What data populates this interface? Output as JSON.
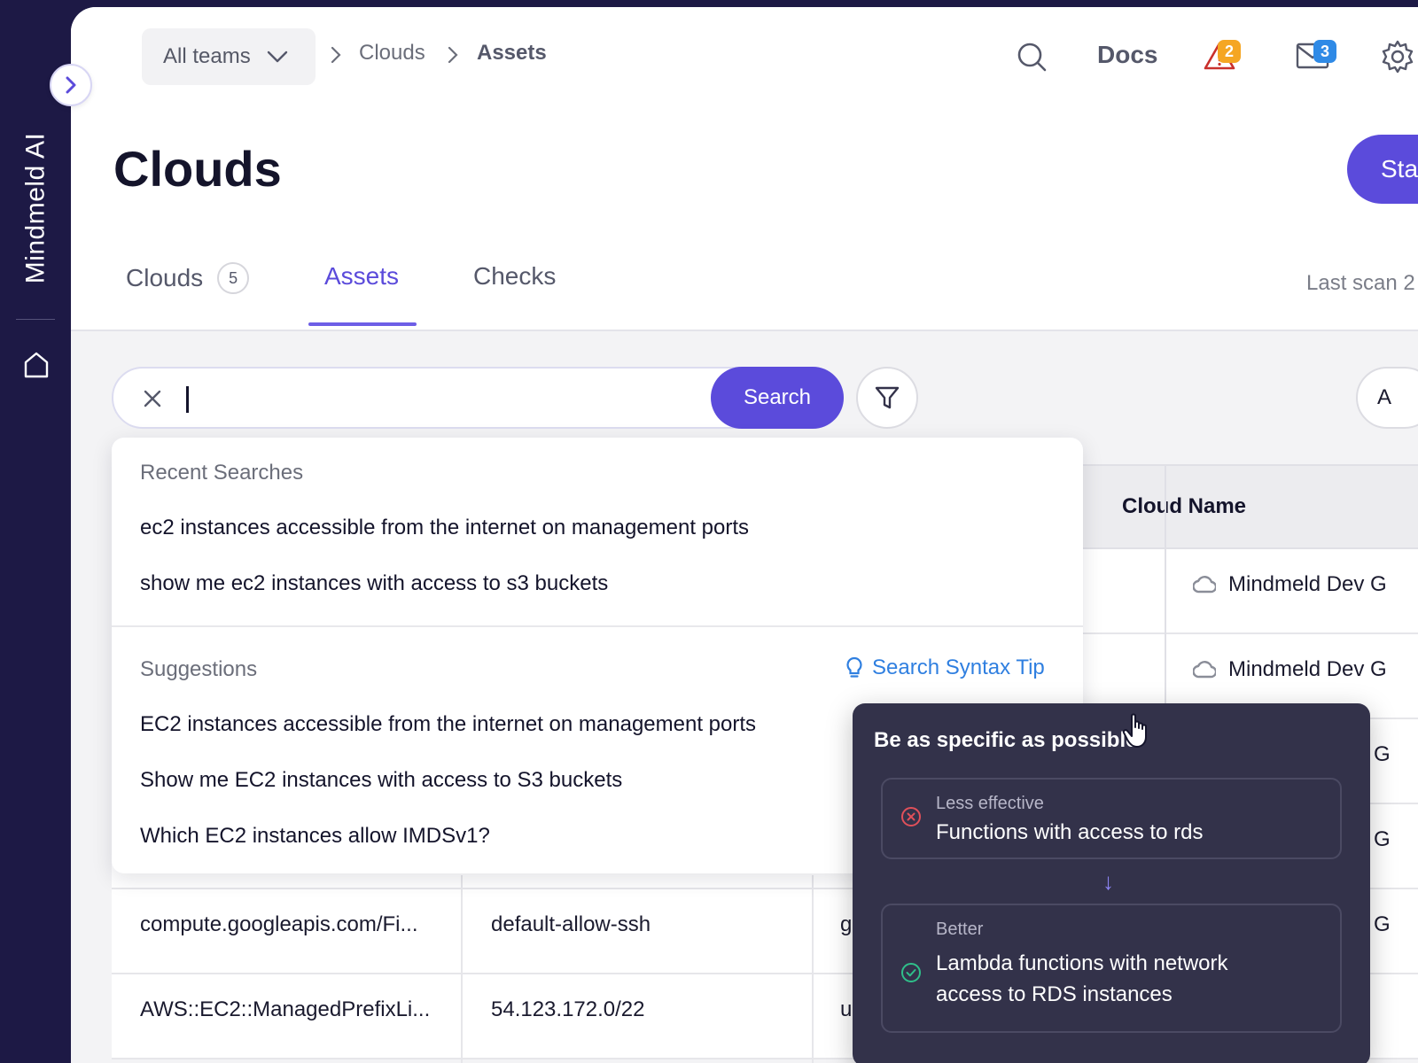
{
  "sidebar": {
    "brand": "Mindmeld AI"
  },
  "header": {
    "team_select": "All teams",
    "breadcrumb": [
      "Clouds",
      "Assets"
    ],
    "docs_label": "Docs",
    "alerts_count": "2",
    "messages_count": "3"
  },
  "page": {
    "title": "Clouds",
    "start_label": "Sta",
    "last_scan": "Last scan 2"
  },
  "tabs": [
    {
      "label": "Clouds",
      "count": "5"
    },
    {
      "label": "Assets"
    },
    {
      "label": "Checks"
    }
  ],
  "search": {
    "value": "",
    "button_label": "Search",
    "right_button_label": "A"
  },
  "dropdown": {
    "recent_label": "Recent Searches",
    "recent": [
      "ec2 instances accessible from the internet on management ports",
      "show me ec2 instances with access to s3 buckets"
    ],
    "suggestions_label": "Suggestions",
    "syntax_tip": "Search Syntax Tip",
    "suggestions": [
      "EC2 instances accessible from the internet on management ports",
      "Show me EC2 instances with access to S3 buckets",
      "Which EC2 instances allow IMDSv1?"
    ]
  },
  "tooltip": {
    "title": "Be as specific as possible",
    "less_label": "Less effective",
    "less_text": "Functions with access to rds",
    "better_label": "Better",
    "better_text_1": "Lambda functions with network",
    "better_text_2": "access to RDS instances"
  },
  "table": {
    "col_cloud_name": "Cloud Name",
    "rows": [
      {
        "col1": "",
        "col2": "",
        "col3": "",
        "cloud": "Mindmeld Dev G"
      },
      {
        "col1": "",
        "col2": "",
        "col3": "",
        "cloud": "Mindmeld Dev G"
      },
      {
        "col1": "",
        "col2": "",
        "col3": "",
        "cloud": "G"
      },
      {
        "col1": "",
        "col2": "",
        "col3": "",
        "cloud": "G"
      },
      {
        "col1": "compute.googleapis.com/Fi...",
        "col2": "default-allow-ssh",
        "col3": "g",
        "cloud": "G"
      },
      {
        "col1": "AWS::EC2::ManagedPrefixLi...",
        "col2": "54.123.172.0/22",
        "col3": "u",
        "cloud": ""
      }
    ]
  },
  "colors": {
    "accent": "#5b4bdb",
    "sidebar": "#1d1945",
    "link": "#2f7fe0",
    "alert_badge": "#f5a623",
    "message_badge": "#2f8ae6"
  }
}
